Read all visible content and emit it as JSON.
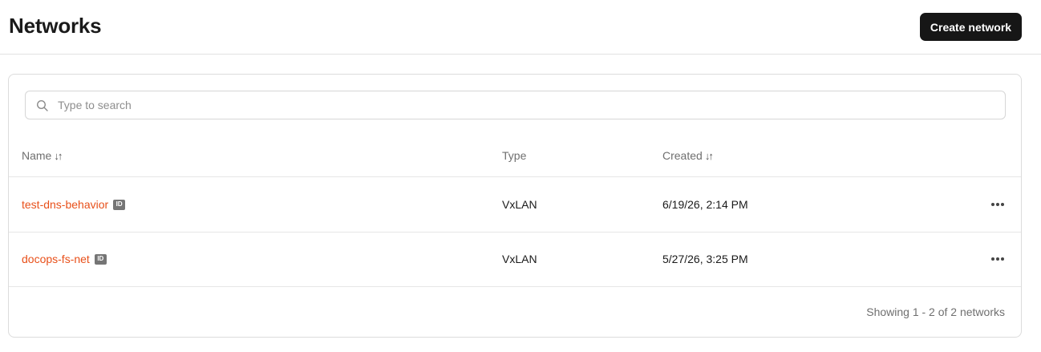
{
  "header": {
    "title": "Networks",
    "create_button_label": "Create network"
  },
  "search": {
    "placeholder": "Type to search",
    "value": ""
  },
  "table": {
    "columns": [
      {
        "label": "Name",
        "sort_icon": "↓↑"
      },
      {
        "label": "Type"
      },
      {
        "label": "Created",
        "sort_icon": "↓↑"
      }
    ],
    "rows": [
      {
        "name": "test-dns-behavior",
        "id_badge": "ID",
        "type": "VxLAN",
        "created": "6/19/26, 2:14 PM"
      },
      {
        "name": "docops-fs-net",
        "id_badge": "ID",
        "type": "VxLAN",
        "created": "5/27/26, 3:25 PM"
      }
    ]
  },
  "footer": {
    "showing_text": "Showing 1 - 2 of 2 networks"
  },
  "colors": {
    "link": "#e8501a",
    "primary_button": "#161616"
  }
}
